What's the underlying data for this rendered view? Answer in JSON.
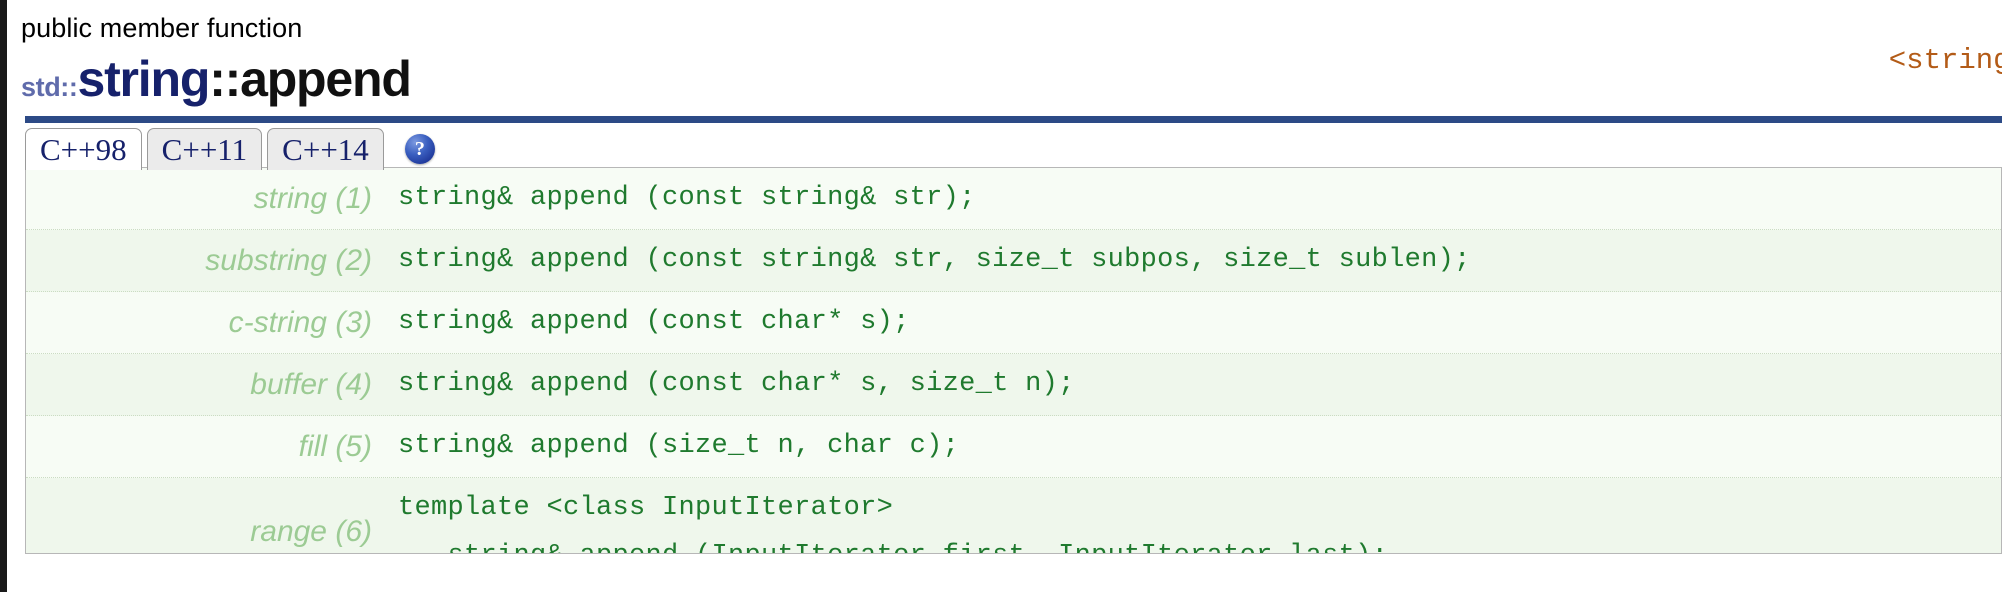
{
  "header": {
    "kind": "public member function",
    "namespace_prefix": "std::",
    "class_name": "string",
    "scope_separator": "::",
    "function_name": "append",
    "header_tag": "<string>"
  },
  "tabs": [
    {
      "label": "C++98",
      "active": true
    },
    {
      "label": "C++11",
      "active": false
    },
    {
      "label": "C++14",
      "active": false
    }
  ],
  "help_icon": {
    "glyph": "?",
    "name": "help-icon"
  },
  "signatures": [
    {
      "label": "string (1)",
      "code": "string& append (const string& str);"
    },
    {
      "label": "substring (2)",
      "code": "string& append (const string& str, size_t subpos, size_t sublen);"
    },
    {
      "label": "c-string (3)",
      "code": "string& append (const char* s);"
    },
    {
      "label": "buffer (4)",
      "code": "string& append (const char* s, size_t n);"
    },
    {
      "label": "fill (5)",
      "code": "string& append (size_t n, char c);"
    },
    {
      "label": "range (6)",
      "code": "template <class InputIterator>\n   string& append (InputIterator first, InputIterator last);"
    }
  ],
  "colors": {
    "accent_blue": "#2c4a86",
    "class_blue": "#16216b",
    "ns_blue": "#5f6bab",
    "code_green": "#1f7a2e",
    "label_green": "#9ccb94",
    "panel_bg": "#f7fcf5",
    "tag_orange": "#b35b17"
  }
}
